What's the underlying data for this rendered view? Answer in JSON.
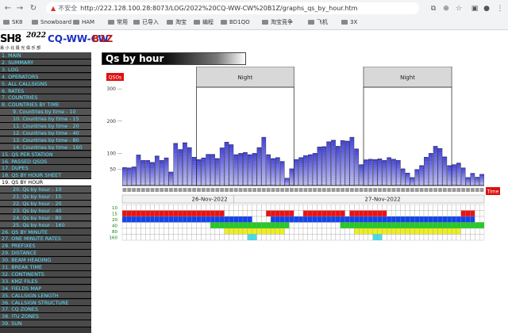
{
  "browser": {
    "url_insecure_label": "不安全",
    "url": "http://222.128.100.28:8073/LOG/2022%20CQ-WW-CW%20B1Z/graphs_qs_by_hour.htm",
    "bookmarks": [
      "SK8",
      "Snowboard",
      "HAM",
      "常用",
      "已导入",
      "淘宝",
      "编程",
      "BD1QO",
      "淘宝竞争",
      "飞机",
      "3X"
    ]
  },
  "logo": {
    "station": "SH8",
    "subtitle": "易 小 北 极 光 俱 乐 部",
    "year": "2022",
    "contest": "CQ-WW-CW",
    "call": "B1Z"
  },
  "menu": [
    {
      "label": "1. MAIN",
      "level": "top"
    },
    {
      "label": "2. SUMMARY",
      "level": "top"
    },
    {
      "label": "3. LOG",
      "level": "top"
    },
    {
      "label": "4. OPERATORS",
      "level": "top"
    },
    {
      "label": "5. ALL CALLSIGNS",
      "level": "top"
    },
    {
      "label": "6. RATES",
      "level": "top"
    },
    {
      "label": "7. COUNTRIES",
      "level": "top"
    },
    {
      "label": "8. COUNTRIES BY TIME",
      "level": "top"
    },
    {
      "label": "9. Countries by time - 10",
      "level": "sub"
    },
    {
      "label": "10. Countries by time - 15",
      "level": "sub"
    },
    {
      "label": "11. Countries by time - 20",
      "level": "sub"
    },
    {
      "label": "12. Countries by time - 40",
      "level": "sub"
    },
    {
      "label": "13. Countries by time - 80",
      "level": "sub"
    },
    {
      "label": "14. Countries by time - 160",
      "level": "sub"
    },
    {
      "label": "15. QS PER STATION",
      "level": "top"
    },
    {
      "label": "16. PASSED QSOS",
      "level": "top"
    },
    {
      "label": "17. DUPES",
      "level": "top"
    },
    {
      "label": "18. QS BY HOUR SHEET",
      "level": "top"
    },
    {
      "label": "19. QS BY HOUR",
      "level": "top",
      "active": true
    },
    {
      "label": "20. Qs by hour - 10",
      "level": "sub"
    },
    {
      "label": "21. Qs by hour - 15",
      "level": "sub"
    },
    {
      "label": "22. Qs by hour - 20",
      "level": "sub"
    },
    {
      "label": "23. Qs by hour - 40",
      "level": "sub"
    },
    {
      "label": "24. Qs by hour - 80",
      "level": "sub"
    },
    {
      "label": "25. Qs by hour - 160",
      "level": "sub"
    },
    {
      "label": "26. QS BY MINUTE",
      "level": "top"
    },
    {
      "label": "27. ONE MINUTE RATES",
      "level": "top"
    },
    {
      "label": "28. PREFIXES",
      "level": "top"
    },
    {
      "label": "29. DISTANCE",
      "level": "top"
    },
    {
      "label": "30. BEAM HEADING",
      "level": "top"
    },
    {
      "label": "31. BREAK TIME",
      "level": "top"
    },
    {
      "label": "32. CONTINENTS",
      "level": "top"
    },
    {
      "label": "33. KMZ FILES",
      "level": "top"
    },
    {
      "label": "34. FIELDS MAP",
      "level": "top"
    },
    {
      "label": "35. CALLSIGN LENGTH",
      "level": "top"
    },
    {
      "label": "36. CALLSIGN STRUCTURE",
      "level": "top"
    },
    {
      "label": "37. CQ ZONES",
      "level": "top"
    },
    {
      "label": "38. ITU ZONES",
      "level": "top"
    },
    {
      "label": "39. SUN",
      "level": "top"
    }
  ],
  "page_title": "Qs by hour",
  "chart_data": {
    "type": "bar",
    "y_label_tag": "QSOs",
    "x_label_tag": "Time",
    "night_label": "Night",
    "dates": [
      "26-Nov-2022",
      "27-Nov-2022"
    ],
    "y_ticks": [
      300,
      200,
      100,
      50
    ],
    "band_labels": [
      "10",
      "15",
      "20",
      "40",
      "80",
      "160"
    ],
    "band_colors": [
      "#ffffff",
      "#ee1111",
      "#1144ee",
      "#22cc22",
      "#eeee22",
      "#44ddee"
    ],
    "values": [
      56,
      55,
      58,
      95,
      78,
      78,
      72,
      92,
      78,
      86,
      42,
      131,
      112,
      133,
      118,
      88,
      81,
      86,
      97,
      97,
      84,
      117,
      135,
      127,
      96,
      100,
      103,
      96,
      100,
      118,
      150,
      96,
      84,
      87,
      75,
      23,
      52,
      81,
      87,
      93,
      96,
      100,
      120,
      121,
      136,
      141,
      122,
      140,
      138,
      150,
      114,
      65,
      80,
      82,
      81,
      83,
      78,
      87,
      82,
      78,
      52,
      39,
      25,
      50,
      62,
      88,
      100,
      122,
      115,
      89,
      62,
      65,
      70,
      55,
      25,
      38,
      26,
      35
    ]
  }
}
